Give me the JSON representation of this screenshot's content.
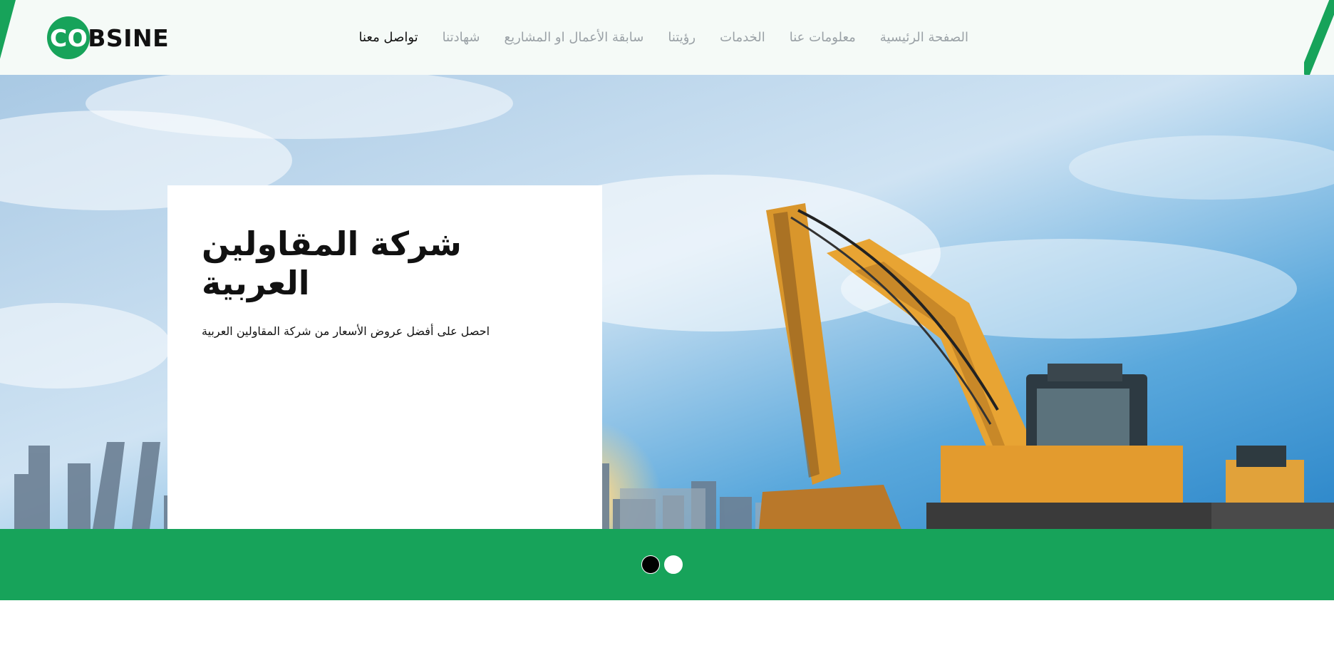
{
  "brand": {
    "logo_co": "CO",
    "logo_rest": "BSINE",
    "accent_color": "#17a35a"
  },
  "nav": {
    "items": [
      {
        "label": "الصفحة الرئيسية",
        "active": false
      },
      {
        "label": "معلومات عنا",
        "active": false
      },
      {
        "label": "الخدمات",
        "active": false
      },
      {
        "label": "رؤيتنا",
        "active": false
      },
      {
        "label": "سابقة الأعمال او المشاريع",
        "active": false
      },
      {
        "label": "شهادتنا",
        "active": false
      },
      {
        "label": "تواصل معنا",
        "active": true
      }
    ]
  },
  "hero": {
    "title": "شركة المقاولين العربية",
    "subtitle": "احصل على أفضل عروض الأسعار من شركة المقاولين العربية",
    "image": "excavator-city-skyline-photo"
  },
  "slider": {
    "dot_count": 2,
    "active_index": 0
  }
}
